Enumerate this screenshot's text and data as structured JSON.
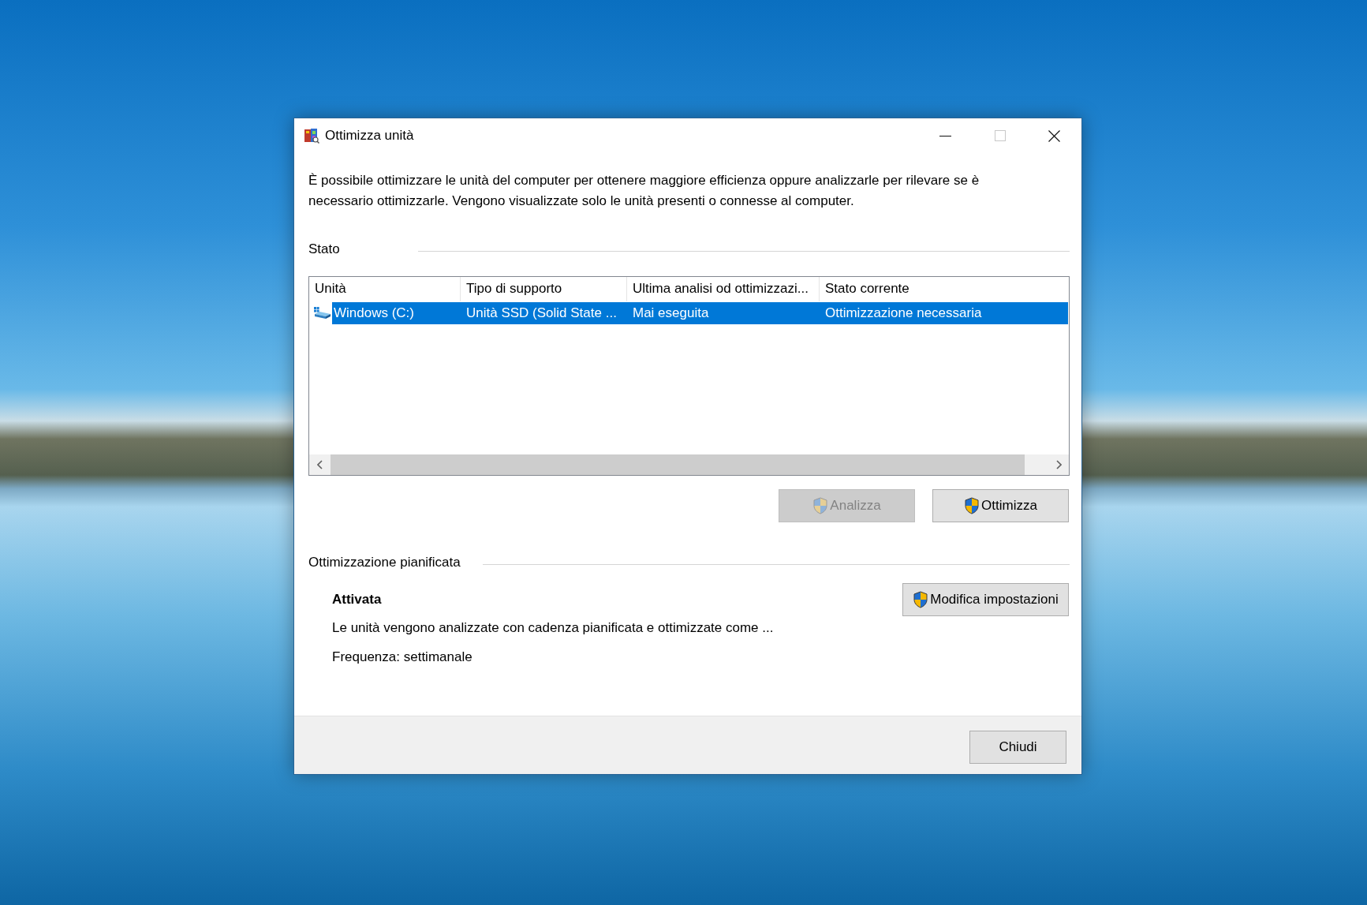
{
  "window": {
    "title": "Ottimizza unità",
    "title_buttons": [
      {
        "kind": "minimize",
        "disabled": false
      },
      {
        "kind": "maximize",
        "disabled": true
      },
      {
        "kind": "close",
        "disabled": false
      }
    ]
  },
  "description": "È possibile ottimizzare le unità del computer per ottenere maggiore efficienza oppure analizzarle per rilevare se è necessario ottimizzarle. Vengono visualizzate solo le unità presenti o connesse al computer.",
  "status": {
    "heading": "Stato",
    "table": {
      "columns": [
        "Unità",
        "Tipo di supporto",
        "Ultima analisi od ottimizzazi...",
        "Stato corrente"
      ],
      "rows": [
        {
          "selected": true,
          "cells": [
            "Windows (C:)",
            "Unità SSD (Solid State ...",
            "Mai eseguita",
            "Ottimizzazione necessaria"
          ]
        }
      ]
    },
    "buttons": [
      {
        "label": "Analizza",
        "disabled": true
      },
      {
        "label": "Ottimizza",
        "disabled": false
      }
    ]
  },
  "schedule": {
    "heading": "Ottimizzazione pianificata",
    "status": "Attivata",
    "description": "Le unità vengono analizzate con cadenza pianificata e ottimizzate come ...",
    "frequency": "Frequenza: settimanale",
    "button": {
      "label": "Modifica impostazioni"
    }
  },
  "footer": {
    "buttons": [
      {
        "label": "Chiudi"
      }
    ]
  }
}
